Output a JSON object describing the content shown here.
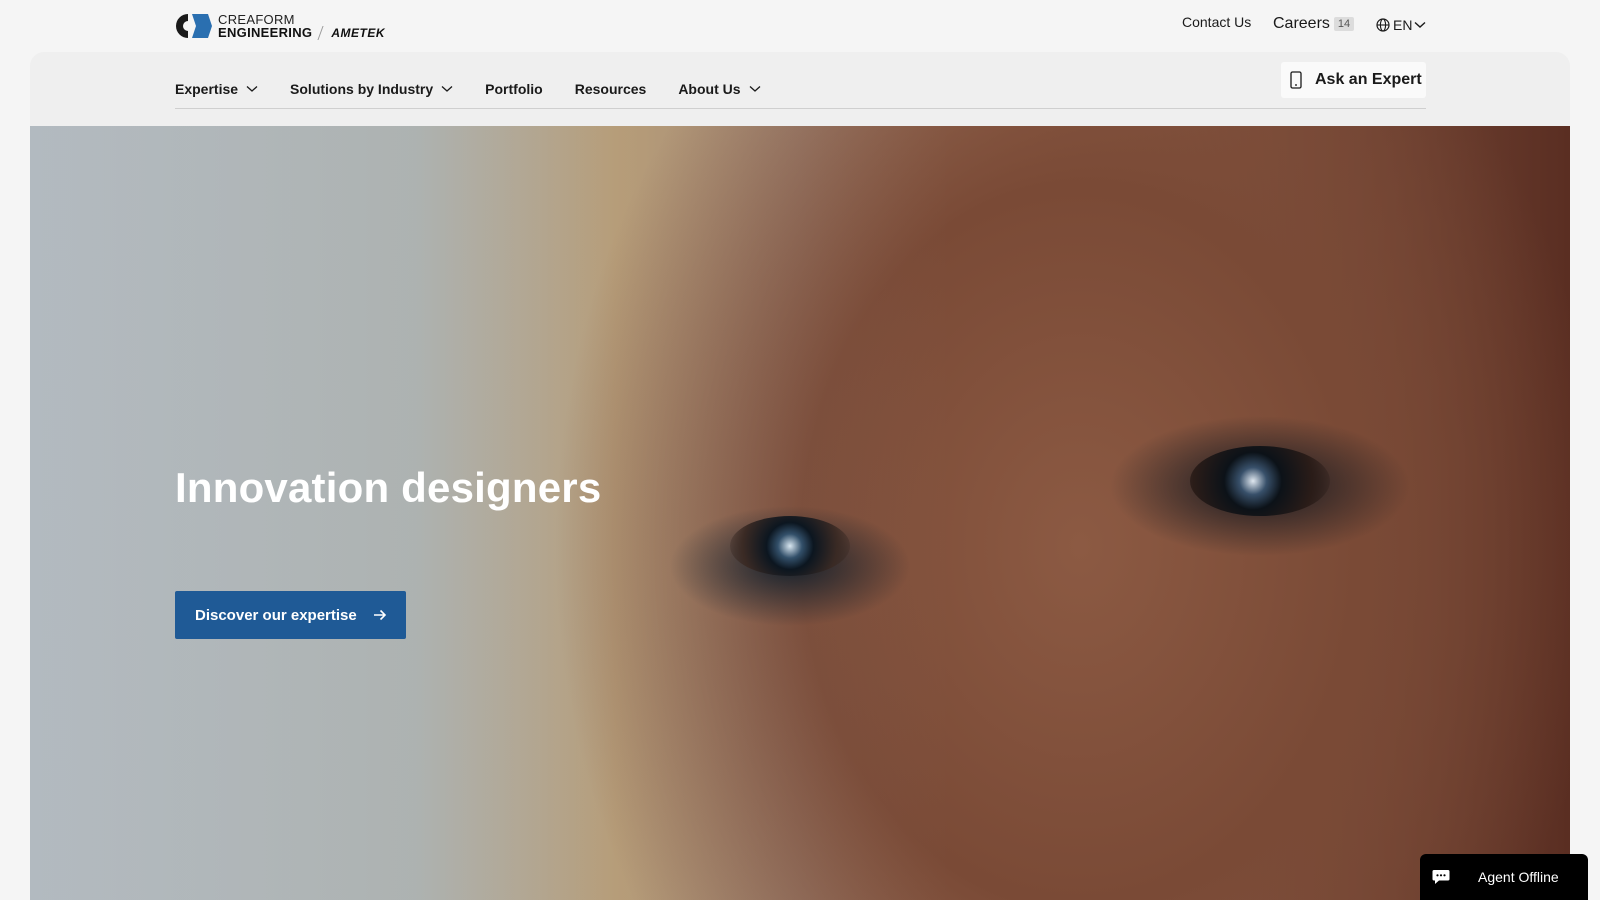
{
  "brand": {
    "line1": "CREAFORM",
    "line2": "ENGINEERING",
    "partner": "AMETEK"
  },
  "utility": {
    "contact": "Contact Us",
    "careers": "Careers",
    "careers_count": "14",
    "language": "EN"
  },
  "nav": {
    "items": [
      {
        "label": "Expertise",
        "dropdown": true
      },
      {
        "label": "Solutions by Industry",
        "dropdown": true
      },
      {
        "label": "Portfolio",
        "dropdown": false
      },
      {
        "label": "Resources",
        "dropdown": false
      },
      {
        "label": "About Us",
        "dropdown": true
      }
    ],
    "ask_expert": "Ask an Expert"
  },
  "hero": {
    "title": "Innovation designers",
    "cta": "Discover our expertise"
  },
  "chat": {
    "status": "Agent Offline"
  },
  "colors": {
    "cta_bg": "#1f5a96",
    "page_bg": "#f5f5f5",
    "chat_bg": "#000000"
  }
}
